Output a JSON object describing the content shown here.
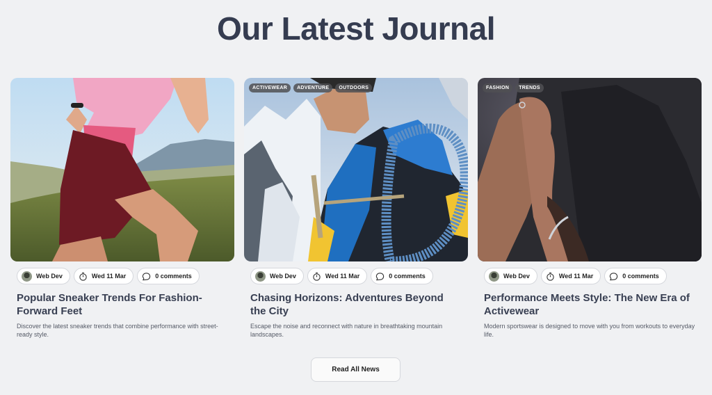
{
  "page": {
    "title": "Our Latest Journal"
  },
  "articles": [
    {
      "tags": [],
      "author": "Web Dev",
      "date": "Wed 11 Mar",
      "comments": "0 comments",
      "title": "Popular Sneaker Trends For Fashion-Forward Feet",
      "excerpt": "Discover the latest sneaker trends that combine performance with street-ready style."
    },
    {
      "tags": [
        "ACTIVEWEAR",
        "ADVENTURE",
        "OUTDOORS"
      ],
      "author": "Web Dev",
      "date": "Wed 11 Mar",
      "comments": "0 comments",
      "title": "Chasing Horizons: Adventures Beyond the City",
      "excerpt": "Escape the noise and reconnect with nature in breathtaking mountain landscapes."
    },
    {
      "tags": [
        "FASHION",
        "TRENDS"
      ],
      "author": "Web Dev",
      "date": "Wed 11 Mar",
      "comments": "0 comments",
      "title": "Performance Meets Style: The New Era of Activewear",
      "excerpt": "Modern sportswear is designed to move with you from workouts to everyday life."
    }
  ],
  "cta": {
    "label": "Read All News"
  },
  "icons": {
    "date": "stopwatch-icon",
    "comments": "comment-bubble-icon"
  },
  "colors": {
    "background": "#f0f1f3",
    "heading": "#353c50",
    "tag_bg": "#505054"
  }
}
